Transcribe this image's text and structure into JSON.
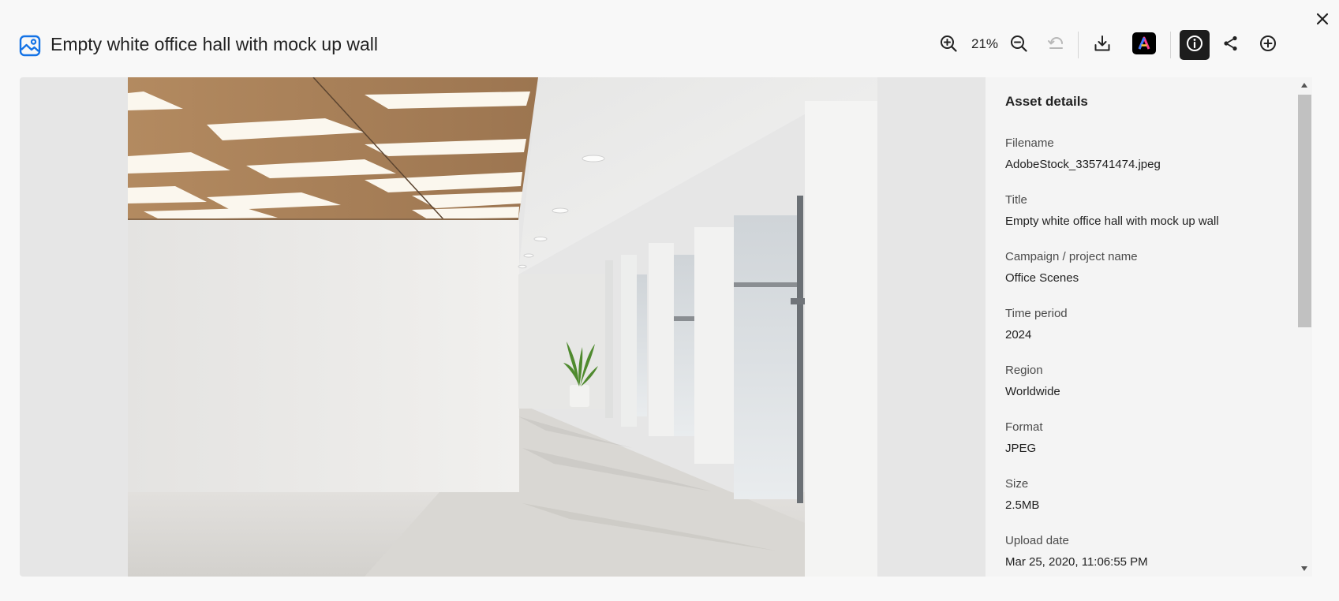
{
  "header": {
    "title": "Empty white office hall with mock up wall",
    "icon": "image-asset-icon",
    "accent_color": "#1473e6"
  },
  "toolbar": {
    "zoom_in_icon": "zoom-in-icon",
    "zoom_level": "21%",
    "zoom_out_icon": "zoom-out-icon",
    "rotate_icon": "rotate-icon",
    "download_icon": "download-icon",
    "adobe_express_icon": "adobe-express-icon",
    "info_icon": "info-icon",
    "share_icon": "share-icon",
    "add_icon": "add-icon"
  },
  "close": {
    "icon": "close-icon"
  },
  "details": {
    "heading": "Asset details",
    "fields": [
      {
        "label": "Filename",
        "value": "AdobeStock_335741474.jpeg"
      },
      {
        "label": "Title",
        "value": "Empty white office hall with mock up wall"
      },
      {
        "label": "Campaign / project name",
        "value": "Office Scenes"
      },
      {
        "label": "Time period",
        "value": "2024"
      },
      {
        "label": "Region",
        "value": "Worldwide"
      },
      {
        "label": "Format",
        "value": "JPEG"
      },
      {
        "label": "Size",
        "value": "2.5MB"
      },
      {
        "label": "Upload date",
        "value": "Mar 25, 2020, 11:06:55 PM"
      }
    ]
  }
}
